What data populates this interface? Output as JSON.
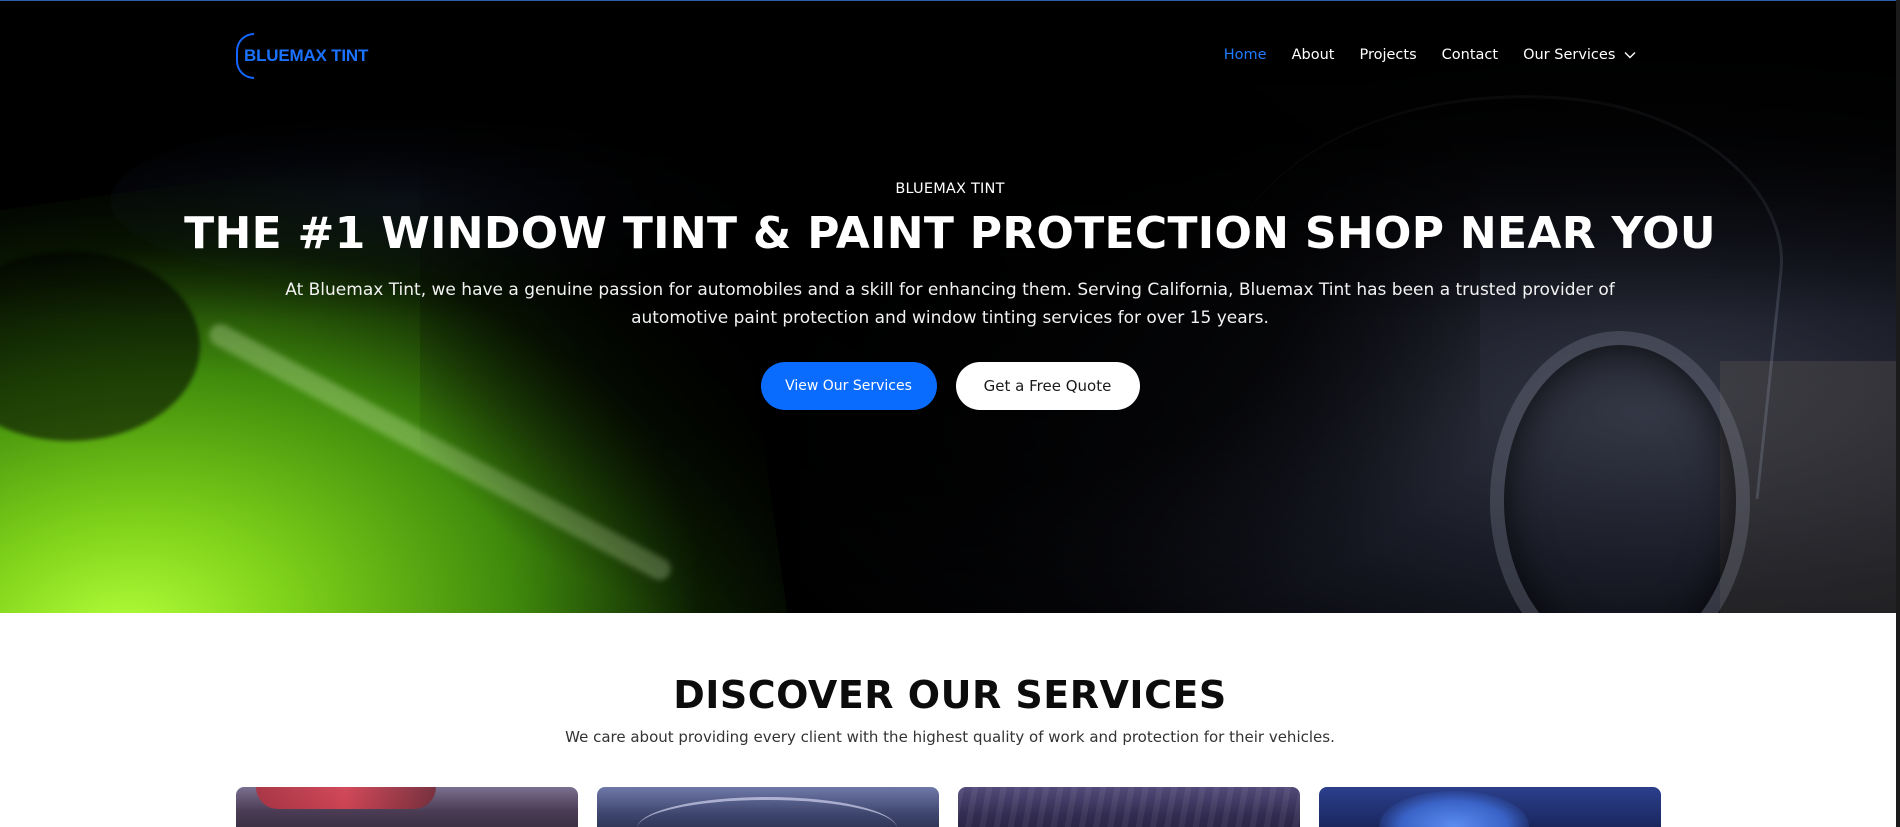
{
  "brand": {
    "logo_text": "BLUEMAX TINT"
  },
  "nav": {
    "items": [
      {
        "label": "Home",
        "active": true
      },
      {
        "label": "About",
        "active": false
      },
      {
        "label": "Projects",
        "active": false
      },
      {
        "label": "Contact",
        "active": false
      },
      {
        "label": "Our Services",
        "active": false,
        "has_dropdown": true
      }
    ]
  },
  "hero": {
    "eyebrow": "BLUEMAX TINT",
    "headline": "THE #1 WINDOW TINT & PAINT PROTECTION SHOP NEAR YOU",
    "lede": "At Bluemax Tint, we have a genuine passion for automobiles and a skill for enhancing them. Serving California, Bluemax Tint has been a trusted provider of automotive paint protection and window tinting services for over 15 years.",
    "primary_cta": "View Our Services",
    "secondary_cta": "Get a Free Quote"
  },
  "services": {
    "title": "DISCOVER OUR SERVICES",
    "subtitle": "We care about providing every client with the highest quality of work and protection for their vehicles."
  },
  "colors": {
    "accent": "#0a6cff",
    "nav_active": "#1f7cff",
    "hero_bg": "#000000",
    "headline": "#ffffff"
  },
  "icons": {
    "dropdown": "chevron-down-icon"
  }
}
